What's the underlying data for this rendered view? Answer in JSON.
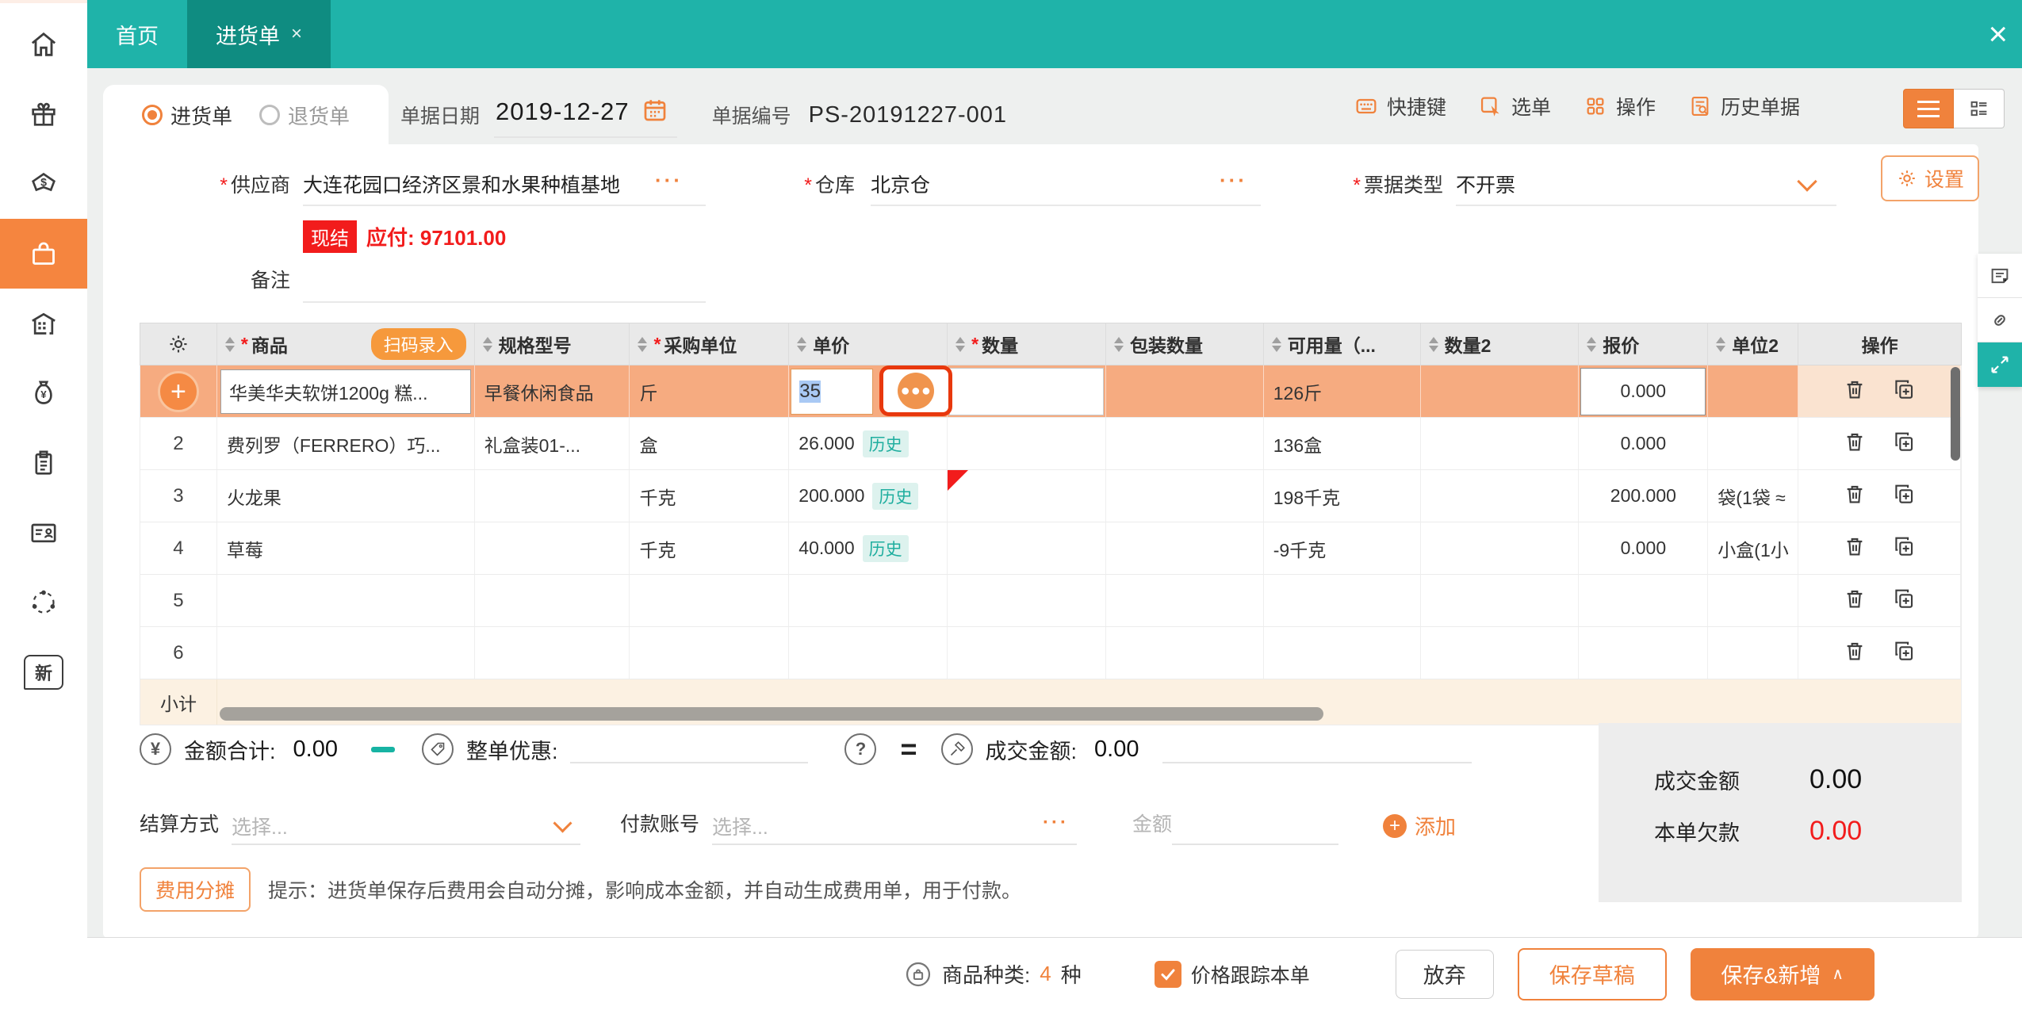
{
  "ui": {
    "required": "*",
    "more": "···",
    "accent": "#f0823c",
    "teal": "#1fb3a9",
    "red": "#f21c1c"
  },
  "topbar": {
    "home_tab": "首页",
    "active_tab": "进货单",
    "close_tab": "×",
    "close_window": "×"
  },
  "sidebar": {
    "new_label": "新"
  },
  "header": {
    "radio_purchase": "进货单",
    "radio_return": "退货单",
    "date_label": "单据日期",
    "date_value": "2019-12-27",
    "no_label": "单据编号",
    "no_value": "PS-20191227-001",
    "btn_hotkeys": "快捷键",
    "btn_pick": "选单",
    "btn_actions": "操作",
    "btn_history": "历史单据"
  },
  "form": {
    "supplier_label": "供应商",
    "supplier_value": "大连花园口经济区景和水果种植基地",
    "settle_badge": "现结",
    "payable": "应付: 97101.00",
    "remark_label": "备注",
    "warehouse_label": "仓库",
    "warehouse_value": "北京仓",
    "invoice_label": "票据类型",
    "invoice_value": "不开票",
    "settings": "设置"
  },
  "table": {
    "h_product": "商品",
    "scan": "扫码录入",
    "h_spec": "规格型号",
    "h_unit": "采购单位",
    "h_price": "单价",
    "h_qty": "数量",
    "h_pkg": "包装数量",
    "h_avail": "可用量（...",
    "h_qty2": "数量2",
    "h_quote": "报价",
    "h_unit2": "单位2",
    "h_action": "操作",
    "history": "历史",
    "rows": [
      {
        "num": "+",
        "product": "华美华夫软饼1200g 糕...",
        "spec": "早餐休闲食品",
        "unit": "斤",
        "price": "35",
        "avail": "126斤",
        "quote": "0.000",
        "unit2": ""
      },
      {
        "num": "2",
        "product": "费列罗（FERRERO）巧...",
        "spec": "礼盒装01-...",
        "unit": "盒",
        "price": "26.000",
        "avail": "136盒",
        "quote": "0.000",
        "unit2": ""
      },
      {
        "num": "3",
        "product": "火龙果",
        "spec": "",
        "unit": "千克",
        "price": "200.000",
        "avail": "198千克",
        "quote": "200.000",
        "unit2": "袋(1袋 ≈"
      },
      {
        "num": "4",
        "product": "草莓",
        "spec": "",
        "unit": "千克",
        "price": "40.000",
        "avail": "-9千克",
        "quote": "0.000",
        "unit2": "小盒(1小"
      },
      {
        "num": "5"
      },
      {
        "num": "6"
      }
    ],
    "subtotal": "小计"
  },
  "summary": {
    "total_label": "金额合计:",
    "total_value": "0.00",
    "discount_label": "整单优惠:",
    "question": "?",
    "equals": "=",
    "deal_label": "成交金额:",
    "deal_value": "0.00"
  },
  "payment": {
    "method_label": "结算方式",
    "method_placeholder": "选择...",
    "account_label": "付款账号",
    "account_placeholder": "选择...",
    "amount_label": "金额",
    "add": "添加"
  },
  "note": {
    "share_btn": "费用分摊",
    "tip": "提示：进货单保存后费用会自动分摊，影响成本金额，并自动生成费用单，用于付款。"
  },
  "totals": {
    "deal_label": "成交金额",
    "deal_value": "0.00",
    "debt_label": "本单欠款",
    "debt_value": "0.00"
  },
  "footer": {
    "kinds_label": "商品种类:",
    "kinds_value": "4",
    "kinds_unit": "种",
    "track_label": "价格跟踪本单",
    "cancel": "放弃",
    "draft": "保存草稿",
    "save_new": "保存&新增",
    "save_caret": "∧"
  }
}
